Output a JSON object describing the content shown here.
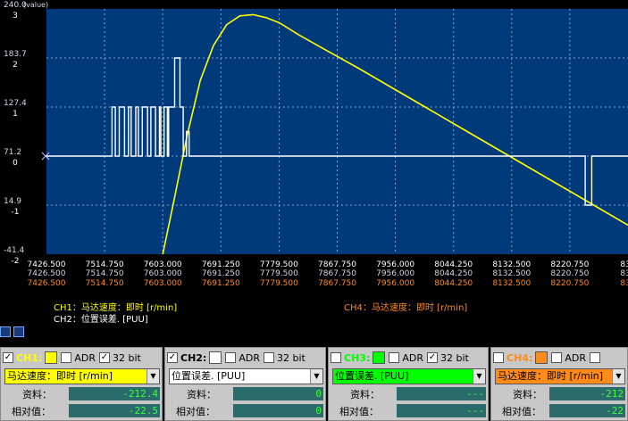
{
  "chart_data": {
    "type": "line",
    "value_unit_label": "(value)",
    "yaxis_left_ticks": [
      "240.0",
      "183.7",
      "127.4",
      "71.2",
      "14.9",
      "-41.4"
    ],
    "yaxis_right_ticks": [
      "3",
      "2",
      "1",
      "0",
      "-1",
      "-2"
    ],
    "x_ticks": [
      "7426.500",
      "7514.750",
      "7603.000",
      "7691.250",
      "7779.500",
      "7867.750",
      "7956.000",
      "8044.250",
      "8132.500",
      "8220.750",
      "830"
    ],
    "x_tick_values": [
      7426.5,
      7514.75,
      7603.0,
      7691.25,
      7779.5,
      7867.75,
      7956.0,
      8044.25,
      8132.5,
      8220.75,
      8309.0
    ],
    "xlim": [
      7426.5,
      8309.0
    ],
    "ylim_left": [
      -41.4,
      240.0
    ],
    "ylim_right": [
      -2,
      3
    ],
    "grid": true,
    "series": [
      {
        "name": "CH1：马达速度：即时 [r/min]",
        "color": "#ffff00",
        "axis": "left",
        "x": [
          7603.0,
          7620,
          7640,
          7660,
          7680,
          7700,
          7720,
          7740,
          7760,
          7780,
          7810,
          7850,
          7900,
          7950,
          8000,
          8050,
          8100,
          8150,
          8200,
          8250,
          8309
        ],
        "y": [
          -41.4,
          20.0,
          95.0,
          158.0,
          198.0,
          222.0,
          232.0,
          233.5,
          230.0,
          224.0,
          210.0,
          193.0,
          172.0,
          150.0,
          128.0,
          106.0,
          84.0,
          62.0,
          40.0,
          18.0,
          -8.0
        ]
      },
      {
        "name": "CH2：位置误差. [PUU]",
        "color": "#ffffff",
        "axis": "right",
        "x": [
          7426.5,
          7526,
          7526,
          7531,
          7531,
          7537,
          7537,
          7545,
          7545,
          7551,
          7551,
          7555,
          7555,
          7562,
          7562,
          7566,
          7566,
          7572,
          7572,
          7580,
          7580,
          7585,
          7585,
          7592,
          7592,
          7598,
          7598,
          7600,
          7600,
          7605,
          7605,
          7610,
          7610,
          7612,
          7612,
          7621,
          7621,
          7629,
          7629,
          7634,
          7634,
          7639,
          7639,
          7643,
          7643,
          8244,
          8244,
          8254,
          8254,
          8309
        ],
        "y": [
          0,
          0,
          1,
          1,
          0,
          0,
          1,
          1,
          0,
          0,
          1,
          1,
          0,
          0,
          1,
          1,
          0,
          0,
          1,
          1,
          0,
          0,
          1,
          1,
          0,
          0,
          1,
          1,
          0,
          0,
          1,
          1,
          0,
          0,
          1,
          1,
          2,
          2,
          1,
          1,
          0,
          0,
          0.5,
          0.5,
          0,
          0,
          -1,
          -1,
          0,
          0
        ]
      }
    ],
    "legend_left": [
      "CH1：马达速度：即时 [r/min]",
      "CH2：位置误差. [PUU]"
    ],
    "legend_right": "CH4：马达速度：即时 [r/min]",
    "legend_colors": {
      "ch1": "#ffff00",
      "ch2": "#ffffff",
      "ch4": "#ff8c1a"
    }
  },
  "panels": [
    {
      "channel_enabled": true,
      "channel_label": "CH1:",
      "channel_color": "#ffff00",
      "adr_checked": false,
      "adr_label": "ADR",
      "bit32_checked": true,
      "bit32_label": "32 bit",
      "select_value": "马达速度：即时 [r/min]",
      "select_bg": "#ffff00",
      "data_label": "资料：",
      "data_value": "-212.4",
      "rel_label": "相对值：",
      "rel_value": "-22.5"
    },
    {
      "channel_enabled": true,
      "channel_label": "CH2:",
      "channel_color": "#ffffff",
      "adr_checked": false,
      "adr_label": "ADR",
      "bit32_checked": false,
      "bit32_label": "32 bit",
      "select_value": "位置误差. [PUU]",
      "select_bg": "#ffffff",
      "data_label": "资料：",
      "data_value": "0",
      "rel_label": "相对值：",
      "rel_value": "0"
    },
    {
      "channel_enabled": false,
      "channel_label": "CH3:",
      "channel_color": "#00ff00",
      "adr_checked": false,
      "adr_label": "ADR",
      "bit32_checked": true,
      "bit32_label": "32 bit",
      "select_value": "位置误差. [PUU]",
      "select_bg": "#00ff00",
      "data_label": "资料：",
      "data_value": "---",
      "rel_label": "相对值：",
      "rel_value": "---"
    },
    {
      "channel_enabled": false,
      "channel_label": "CH4:",
      "channel_color": "#ff8c1a",
      "adr_checked": false,
      "adr_label": "ADR",
      "bit32_checked": false,
      "bit32_label": "",
      "select_value": "马达速度：即时 [r/min]",
      "select_bg": "#ff8c1a",
      "data_label": "资料：",
      "data_value": "-212",
      "rel_label": "相对值：",
      "rel_value": "-22"
    }
  ]
}
